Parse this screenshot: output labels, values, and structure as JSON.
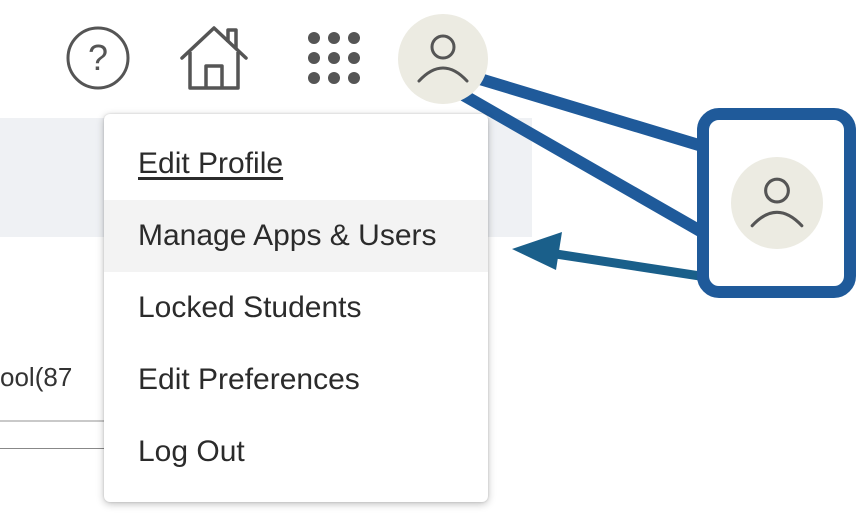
{
  "background": {
    "row_text": "ool(87"
  },
  "toolbar": {
    "icons": [
      "help-icon",
      "home-icon",
      "apps-grid-icon",
      "user-avatar-icon"
    ]
  },
  "menu": {
    "items": [
      {
        "label": "Edit Profile"
      },
      {
        "label": "Manage Apps & Users"
      },
      {
        "label": "Locked Students"
      },
      {
        "label": "Edit Preferences"
      },
      {
        "label": "Log Out"
      }
    ]
  },
  "colors": {
    "callout_border": "#1f5a9a",
    "callout_arrow": "#1a5f8a",
    "avatar_bg": "#ecebe2",
    "highlight_row": "#f3f3f3"
  }
}
